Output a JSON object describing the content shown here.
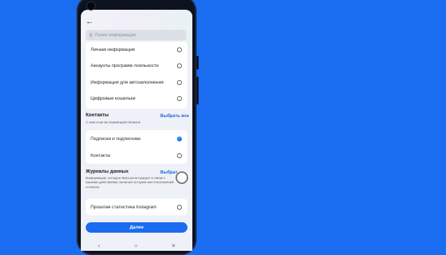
{
  "search": {
    "placeholder": "Поиск информации"
  },
  "section_top": {
    "items": [
      {
        "label": "Личная информация",
        "selected": false
      },
      {
        "label": "Аккаунты программ лояльности",
        "selected": false
      },
      {
        "label": "Информация для автозаполнения",
        "selected": false
      },
      {
        "label": "Цифровые кошельки",
        "selected": false
      }
    ]
  },
  "contacts": {
    "title": "Контакты",
    "select_all": "Выбрать все",
    "description": "С кем и как вы взаимодействовали",
    "items": [
      {
        "label": "Подписки и подписчики",
        "selected": true
      },
      {
        "label": "Контакты",
        "selected": false
      }
    ]
  },
  "logs": {
    "title": "Журналы данных",
    "select_all": "Выбрат",
    "description": "Информация, которую Meta регистрирует в связи с вашими действиями, включая историю местоположений и поиска",
    "items": [
      {
        "label": "Прошлая статистика Instagram",
        "selected": false
      }
    ]
  },
  "footer": {
    "next_label": "Далее"
  },
  "icons": {
    "back": "arrow-left-icon",
    "search": "search-icon",
    "check": "check-icon"
  },
  "colors": {
    "accent": "#1a6cf0",
    "background": "#1a6cf0"
  }
}
